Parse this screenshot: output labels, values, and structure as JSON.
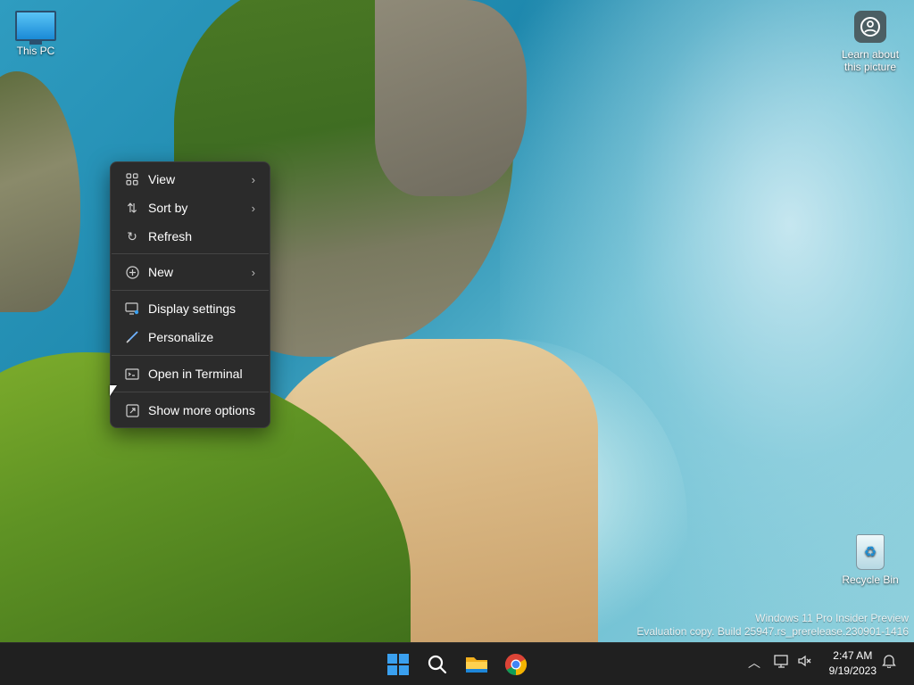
{
  "desktop": {
    "icons": [
      {
        "label": "This PC",
        "icon": "computer-icon"
      },
      {
        "label": "Learn about this picture",
        "icon": "camera-info-icon"
      },
      {
        "label": "Recycle Bin",
        "icon": "recycle-bin-icon"
      }
    ],
    "watermark": {
      "line1": "Windows 11 Pro Insider Preview",
      "line2": "Evaluation copy. Build 25947.rs_prerelease.230901-1416"
    }
  },
  "context_menu": {
    "items": [
      {
        "label": "View",
        "icon": "grid-view-icon",
        "submenu": true
      },
      {
        "label": "Sort by",
        "icon": "sort-icon",
        "submenu": true
      },
      {
        "label": "Refresh",
        "icon": "refresh-icon",
        "submenu": false
      },
      {
        "label": "New",
        "icon": "plus-circle-icon",
        "submenu": true
      },
      {
        "label": "Display settings",
        "icon": "display-settings-icon",
        "submenu": false
      },
      {
        "label": "Personalize",
        "icon": "brush-icon",
        "submenu": false
      },
      {
        "label": "Open in Terminal",
        "icon": "terminal-icon",
        "submenu": false
      },
      {
        "label": "Show more options",
        "icon": "more-options-icon",
        "submenu": false
      }
    ]
  },
  "taskbar": {
    "apps": [
      {
        "name": "Start",
        "icon": "windows-start-icon"
      },
      {
        "name": "Search",
        "icon": "search-icon"
      },
      {
        "name": "File Explorer",
        "icon": "folder-icon"
      },
      {
        "name": "Google Chrome",
        "icon": "chrome-icon"
      }
    ],
    "time": "2:47 AM",
    "date": "9/19/2023"
  }
}
